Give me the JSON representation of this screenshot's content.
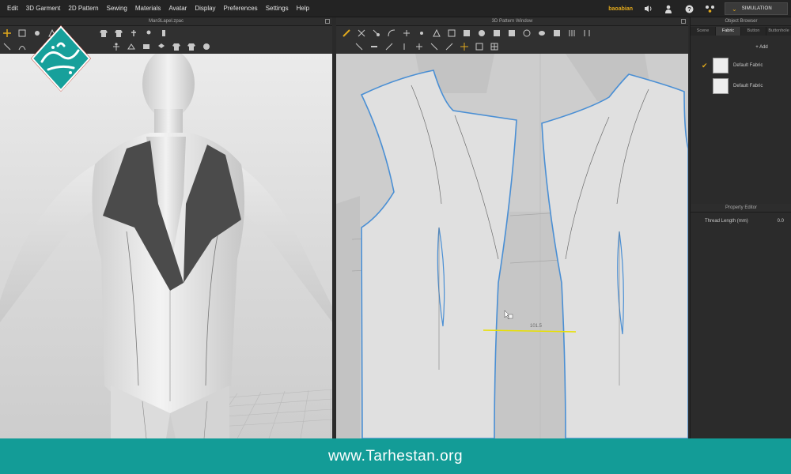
{
  "menu": [
    "Edit",
    "3D Garment",
    "2D Pattern",
    "Sewing",
    "Materials",
    "Avatar",
    "Display",
    "Preferences",
    "Settings",
    "Help"
  ],
  "header": {
    "user": "baoabian",
    "sim_label": "SIMULATION",
    "icons": [
      "speaker-icon",
      "person-icon",
      "help-icon",
      "network-icon"
    ]
  },
  "panel_3d": {
    "title": "Man3Lapel.zpac"
  },
  "panel_2d": {
    "title": "3D Pattern Window",
    "measure_label": "101.5"
  },
  "object_browser": {
    "title": "Object Browser",
    "tabs": [
      "Scene",
      "Fabric",
      "Button",
      "Buttonhole"
    ],
    "active_tab": "Fabric",
    "add_label": "+ Add",
    "fabrics": [
      {
        "name": "Default Fabric",
        "checked": true
      },
      {
        "name": "Default Fabric",
        "checked": false
      }
    ]
  },
  "property_editor": {
    "title": "Property Editor",
    "rows": [
      {
        "label": "Thread Length (mm)",
        "value": "0.0"
      }
    ]
  },
  "footer": {
    "website": "www.Tarhestan.org"
  },
  "colors": {
    "accent": "#e0a81c",
    "footer": "#139c97",
    "pattern_outline": "#4a8fd4",
    "measure": "#e8e000"
  }
}
